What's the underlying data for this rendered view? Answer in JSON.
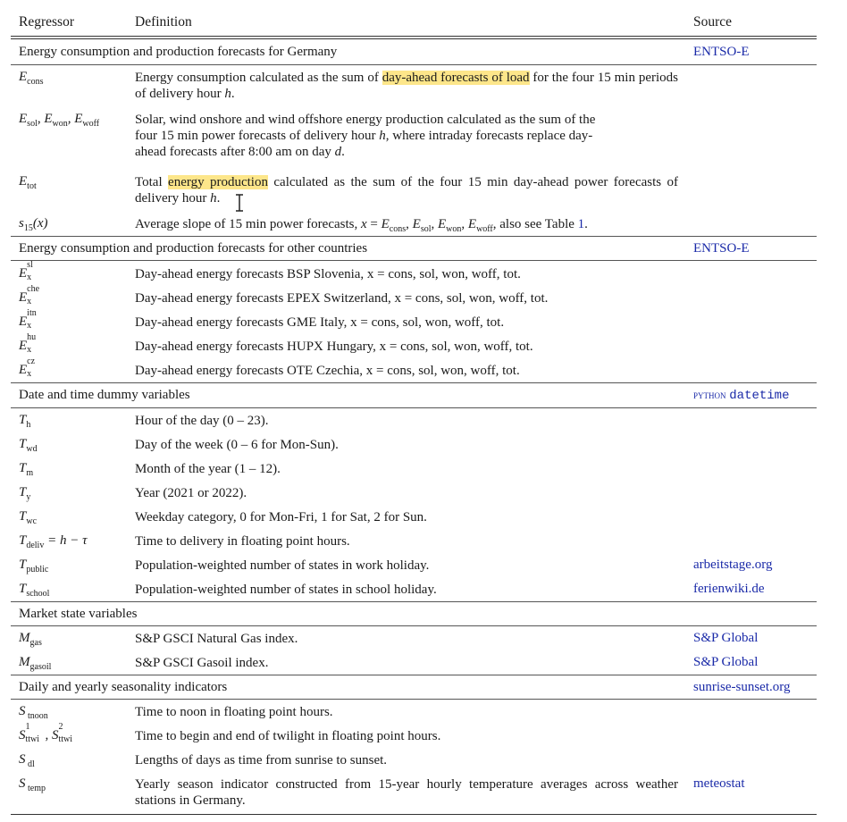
{
  "header": {
    "col1": "Regressor",
    "col2": "Definition",
    "col3": "Source"
  },
  "sections": [
    {
      "title": "Energy consumption and production forecasts for Germany",
      "source": "ENTSO-E"
    },
    {
      "title": "Energy consumption and production forecasts for other countries",
      "source": "ENTSO-E"
    },
    {
      "title": "Date and time dummy variables",
      "source_prefix": "python",
      "source_mono": "datetime"
    },
    {
      "title": "Market state variables",
      "source": ""
    },
    {
      "title": "Daily and yearly seasonality indicators",
      "source": "sunrise-sunset.org"
    }
  ],
  "rows": {
    "econs": {
      "def_a": "Energy consumption calculated as the sum of ",
      "def_hl": "day-ahead forecasts of load",
      "def_b": " for the four 15 min periods of delivery hour ",
      "def_h": "h",
      "def_end": "."
    },
    "esol": {
      "def_a": "Solar, wind onshore and wind offshore energy production calculated as the sum of the four 15 min power forecasts of delivery hour ",
      "def_h": "h",
      "def_b": ", where intraday forecasts replace day-ahead forecasts after 8:00 am on day ",
      "def_d": "d",
      "def_end": "."
    },
    "etot": {
      "def_a": "Total ",
      "def_hl": "energy production",
      "def_b": " calculated as the sum of the four 15 min day-ahead power forecasts of delivery hour ",
      "def_h": "h",
      "def_end": "."
    },
    "s15": {
      "def_a": "Average slope of 15 min power forecasts, ",
      "def_b": ", also see Table ",
      "table_ref": "1",
      "def_end": "."
    },
    "sl": {
      "sup": "sl",
      "def": "Day-ahead energy forecasts BSP Slovenia, x = cons, sol, won, woff, tot."
    },
    "che": {
      "sup": "che",
      "def": "Day-ahead energy forecasts EPEX Switzerland, x = cons, sol, won, woff, tot."
    },
    "itn": {
      "sup": "itn",
      "def": "Day-ahead energy forecasts GME Italy, x = cons, sol, won, woff, tot."
    },
    "hu": {
      "sup": "hu",
      "def": "Day-ahead energy forecasts HUPX Hungary, x = cons, sol, won, woff, tot."
    },
    "cz": {
      "sup": "cz",
      "def": "Day-ahead energy forecasts OTE Czechia, x = cons, sol, won, woff, tot."
    },
    "th": {
      "def": "Hour of the day (0 – 23)."
    },
    "twd": {
      "def": "Day of the week (0 – 6 for Mon-Sun)."
    },
    "tm": {
      "def": "Month of the year (1 – 12)."
    },
    "ty": {
      "def": "Year (2021 or 2022)."
    },
    "twc": {
      "def": "Weekday category, 0 for Mon-Fri, 1 for Sat, 2 for Sun."
    },
    "tdeliv": {
      "def": "Time to delivery in floating point hours."
    },
    "tpublic": {
      "def": "Population-weighted number of states in work holiday.",
      "source": "arbeitstage.org"
    },
    "tschool": {
      "def": "Population-weighted number of states in school holiday.",
      "source": "ferienwiki.de"
    },
    "mgas": {
      "def": "S&P GSCI Natural Gas index.",
      "source": "S&P Global"
    },
    "mgasoil": {
      "def": "S&P GSCI Gasoil index.",
      "source": "S&P Global"
    },
    "stnoon": {
      "def": "Time to noon in floating point hours."
    },
    "sttwi": {
      "def": "Time to begin and end of twilight in floating point hours."
    },
    "sdl": {
      "def": "Lengths of days as time from sunrise to sunset."
    },
    "stemp": {
      "def": "Yearly season indicator constructed from 15-year hourly temperature averages across weather stations in Germany.",
      "source": "meteostat"
    }
  }
}
